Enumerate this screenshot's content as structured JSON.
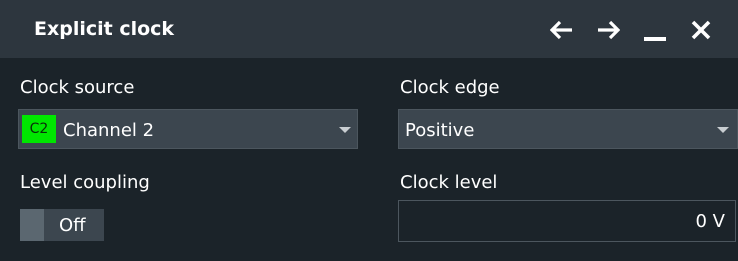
{
  "dialog": {
    "title": "Explicit clock",
    "buttons": {
      "back": "left-arrow-icon",
      "forward": "right-arrow-icon",
      "minimize": "minimize-icon",
      "close": "close-icon"
    }
  },
  "clock_source": {
    "label": "Clock source",
    "chip": "C2",
    "chip_color": "#00e600",
    "value": "Channel 2"
  },
  "clock_edge": {
    "label": "Clock edge",
    "value": "Positive"
  },
  "level_coupling": {
    "label": "Level coupling",
    "state": "Off"
  },
  "clock_level": {
    "label": "Clock level",
    "value": "0 V"
  }
}
